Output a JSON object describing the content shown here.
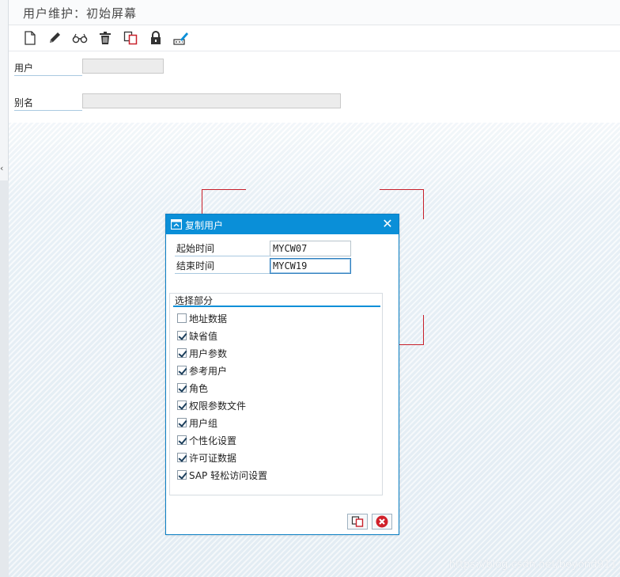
{
  "window": {
    "title": "用户维护：初始屏幕"
  },
  "toolbar": {
    "buttons": [
      {
        "name": "create",
        "icon": "new-document-icon"
      },
      {
        "name": "change",
        "icon": "pencil-icon"
      },
      {
        "name": "display",
        "icon": "glasses-icon"
      },
      {
        "name": "delete",
        "icon": "trash-icon"
      },
      {
        "name": "copy",
        "icon": "copy-icon"
      },
      {
        "name": "lock",
        "icon": "lock-icon"
      },
      {
        "name": "change-password",
        "icon": "password-pen-icon"
      }
    ]
  },
  "form": {
    "user_label": "用户",
    "user_value": "",
    "alias_label": "别名",
    "alias_value": ""
  },
  "dialog": {
    "title": "复制用户",
    "from_label": "起始时间",
    "from_value": "MYCW07",
    "to_label": "结束时间",
    "to_value": "MYCW19",
    "group_title": "选择部分",
    "options": [
      {
        "label": "地址数据",
        "checked": false
      },
      {
        "label": "缺省值",
        "checked": true
      },
      {
        "label": "用户参数",
        "checked": true
      },
      {
        "label": "参考用户",
        "checked": true
      },
      {
        "label": "角色",
        "checked": true
      },
      {
        "label": "权限参数文件",
        "checked": true
      },
      {
        "label": "用户组",
        "checked": true
      },
      {
        "label": "个性化设置",
        "checked": true
      },
      {
        "label": "许可证数据",
        "checked": true
      },
      {
        "label": "SAP 轻松访问设置",
        "checked": true
      }
    ]
  },
  "watermark": "https://blog.csdn.net/beyond911",
  "colors": {
    "accent": "#0a8fd8",
    "highlight_red": "#c8202a",
    "cancel_red": "#d0202a"
  }
}
